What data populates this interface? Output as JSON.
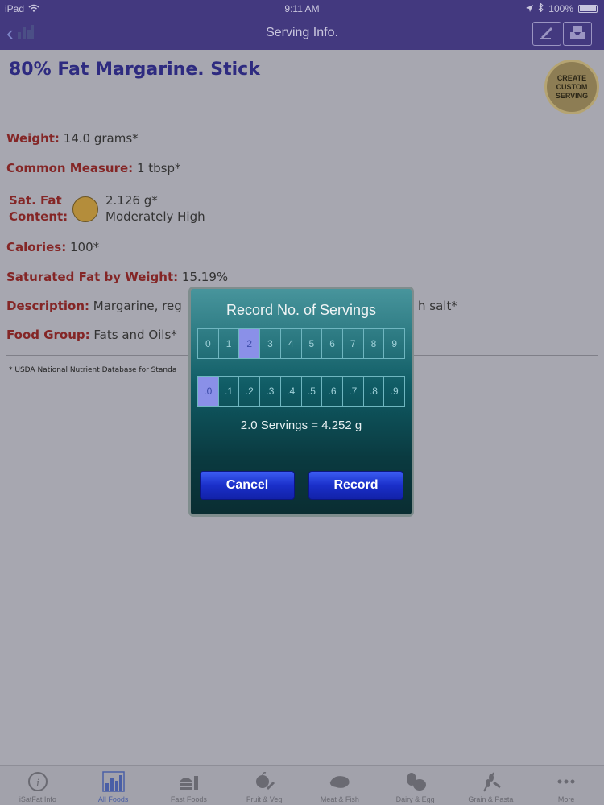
{
  "status_bar": {
    "carrier": "iPad",
    "time": "9:11 AM",
    "battery": "100%"
  },
  "nav": {
    "title": "Serving Info."
  },
  "food": {
    "title": "80% Fat Margarine. Stick",
    "custom_badge": [
      "CREATE",
      "CUSTOM",
      "SERVING"
    ],
    "weight_label": "Weight:",
    "weight_value": "14.0 grams*",
    "measure_label": "Common Measure:",
    "measure_value": "1 tbsp*",
    "satfat_label_1": "Sat. Fat",
    "satfat_label_2": "Content:",
    "satfat_value": "2.126 g*",
    "satfat_rating": "Moderately High",
    "calories_label": "Calories:",
    "calories_value": "100*",
    "satfat_weight_label": "Saturated Fat by Weight:",
    "satfat_weight_value": "15.19%",
    "description_label": "Description:",
    "description_value_left": "Margarine, reg",
    "description_value_right": "h salt*",
    "group_label": "Food Group:",
    "group_value": "Fats and Oils*",
    "footnote": "* USDA National Nutrient Database for Standa"
  },
  "dialog": {
    "title": "Record No. of Servings",
    "whole_digits": [
      "0",
      "1",
      "2",
      "3",
      "4",
      "5",
      "6",
      "7",
      "8",
      "9"
    ],
    "whole_selected": "2",
    "decimal_digits": [
      ".0",
      ".1",
      ".2",
      ".3",
      ".4",
      ".5",
      ".6",
      ".7",
      ".8",
      ".9"
    ],
    "decimal_selected": ".0",
    "summary": "2.0 Servings = 4.252 g",
    "cancel_label": "Cancel",
    "record_label": "Record"
  },
  "tabs": [
    {
      "label": "iSatFat Info",
      "icon": "info-icon"
    },
    {
      "label": "All Foods",
      "icon": "bar-chart-icon",
      "active": true
    },
    {
      "label": "Fast Foods",
      "icon": "burger-icon"
    },
    {
      "label": "Fruit & Veg",
      "icon": "apple-icon"
    },
    {
      "label": "Meat & Fish",
      "icon": "steak-icon"
    },
    {
      "label": "Dairy & Egg",
      "icon": "egg-icon"
    },
    {
      "label": "Grain & Pasta",
      "icon": "wheat-icon"
    },
    {
      "label": "More",
      "icon": "more-icon"
    }
  ]
}
